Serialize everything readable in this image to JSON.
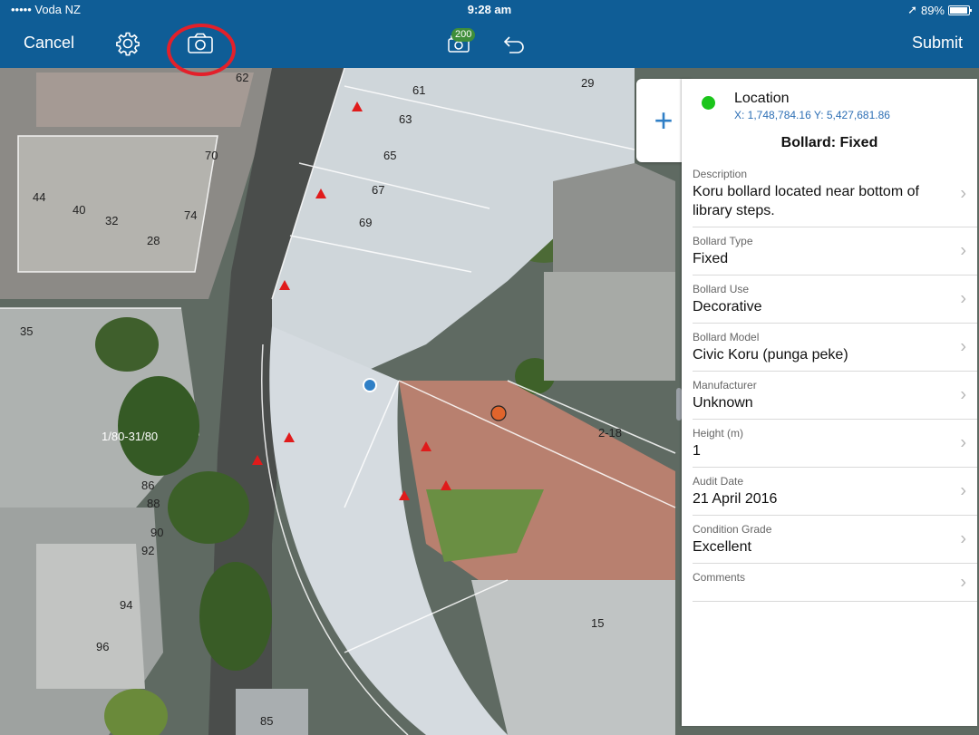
{
  "status_bar": {
    "carrier": "••••• Voda NZ",
    "time": "9:28 am",
    "battery": "89%"
  },
  "toolbar": {
    "cancel_label": "Cancel",
    "submit_label": "Submit",
    "photo_count": "200"
  },
  "map": {
    "building_labels": [
      "62",
      "61",
      "29",
      "63",
      "65",
      "67",
      "69",
      "70",
      "74",
      "44",
      "40",
      "32",
      "28",
      "35",
      "1/80-31/80",
      "86",
      "88",
      "90",
      "92",
      "94",
      "96",
      "2-18",
      "15",
      "85"
    ]
  },
  "panel": {
    "location_label": "Location",
    "coordinates": "X: 1,748,784.16 Y: 5,427,681.86",
    "title": "Bollard: Fixed",
    "fields": [
      {
        "label": "Description",
        "value": "Koru bollard located near bottom of library steps."
      },
      {
        "label": "Bollard Type",
        "value": "Fixed"
      },
      {
        "label": "Bollard Use",
        "value": "Decorative"
      },
      {
        "label": "Bollard Model",
        "value": "Civic Koru (punga peke)"
      },
      {
        "label": "Manufacturer",
        "value": "Unknown"
      },
      {
        "label": "Height (m)",
        "value": "1"
      },
      {
        "label": "Audit Date",
        "value": "21 April 2016"
      },
      {
        "label": "Condition Grade",
        "value": "Excellent"
      },
      {
        "label": "Comments",
        "value": ""
      }
    ]
  },
  "colors": {
    "toolbar": "#0f5d96",
    "accent": "#2f7fc6",
    "location_dot": "#1bc51b",
    "marker": "#e01b1b",
    "selected_point": "#e0642c",
    "highlight_ring": "#e3202a"
  }
}
